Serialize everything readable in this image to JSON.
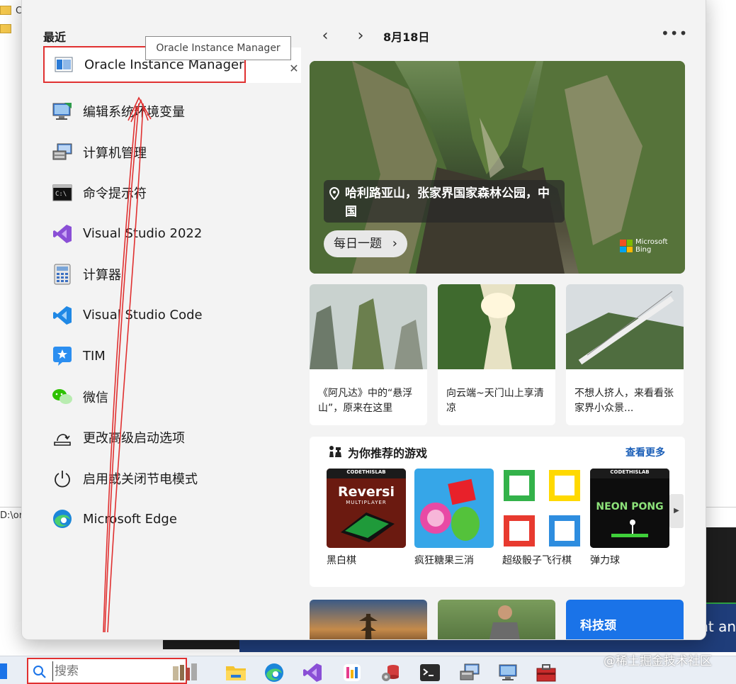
{
  "start_menu": {
    "recent_heading": "最近",
    "tooltip_text": "Oracle Instance Manager",
    "recent_items": [
      {
        "label": "Oracle Instance Manager",
        "icon": "oracle-icon"
      },
      {
        "label": "编辑系统环境变量",
        "icon": "system-env-icon"
      },
      {
        "label": "计算机管理",
        "icon": "computer-management-icon"
      },
      {
        "label": "命令提示符",
        "icon": "command-prompt-icon"
      },
      {
        "label": "Visual Studio 2022",
        "icon": "visual-studio-icon"
      },
      {
        "label": "计算器",
        "icon": "calculator-icon"
      },
      {
        "label": "Visual Studio Code",
        "icon": "vscode-icon"
      },
      {
        "label": "TIM",
        "icon": "tim-icon"
      },
      {
        "label": "微信",
        "icon": "wechat-icon"
      },
      {
        "label": "更改高级启动选项",
        "icon": "advanced-startup-icon"
      },
      {
        "label": "启用或关闭节电模式",
        "icon": "power-icon"
      },
      {
        "label": "Microsoft Edge",
        "icon": "edge-icon"
      }
    ]
  },
  "widgets": {
    "date": "8月18日",
    "hero": {
      "location": "哈利路亚山，张家界国家森林公园，中国",
      "daily_button": "每日一题",
      "brand_line1": "Microsoft",
      "brand_line2": "Bing"
    },
    "news": [
      {
        "title": "《阿凡达》中的“悬浮山”，原来在这里"
      },
      {
        "title": "向云端~天门山上享清凉"
      },
      {
        "title": "不想人挤人，来看看张家界小众景..."
      }
    ],
    "games": {
      "heading": "为你推荐的游戏",
      "see_more": "查看更多",
      "items": [
        {
          "label": "黑白棋",
          "tile_text": "Reversi",
          "tile_sub": "MULTIPLAYER",
          "badge": "CODETHISLAB"
        },
        {
          "label": "疯狂糖果三消"
        },
        {
          "label": "超级骰子飞行棋"
        },
        {
          "label": "弹力球",
          "tile_text": "NEON PONG",
          "badge": "CODETHISLAB"
        }
      ]
    },
    "bottom_cards": [
      {
        "label": ""
      },
      {
        "label": ""
      },
      {
        "label": "科技颈"
      }
    ]
  },
  "background": {
    "folder_letter": "C",
    "path_fragment": "D:\\or",
    "right_fragment": "nt an"
  },
  "taskbar": {
    "search_placeholder": "搜索"
  },
  "watermark": "@稀土掘金技术社区",
  "colors": {
    "annotation_red": "#e03030",
    "link_blue": "#1b5fb8",
    "tech_card_blue": "#1a73e8"
  }
}
